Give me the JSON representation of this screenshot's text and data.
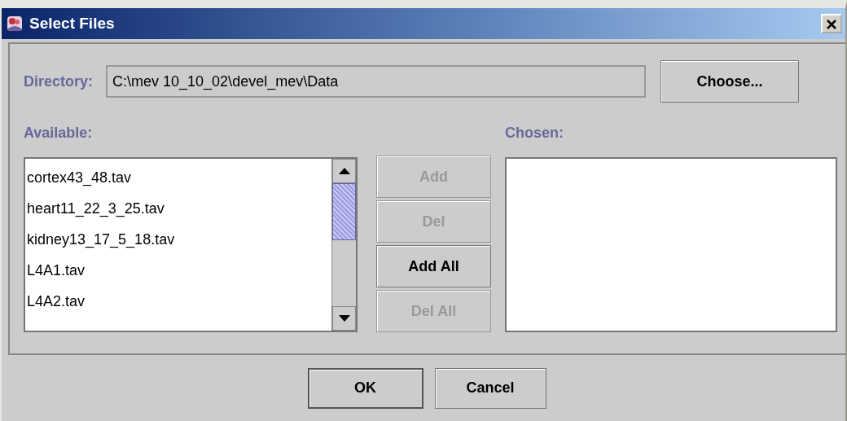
{
  "window": {
    "title": "Select Files"
  },
  "directory": {
    "label": "Directory:",
    "value": "C:\\mev 10_10_02\\devel_mev\\Data",
    "button": "Choose..."
  },
  "available": {
    "label": "Available:",
    "items": [
      "cortex43_48.tav",
      "heart11_22_3_25.tav",
      "kidney13_17_5_18.tav",
      "L4A1.tav",
      "L4A2.tav"
    ]
  },
  "transfer_buttons": [
    {
      "label": "Add",
      "disabled": true
    },
    {
      "label": "Del",
      "disabled": true
    },
    {
      "label": "Add All",
      "disabled": false
    },
    {
      "label": "Del All",
      "disabled": true
    }
  ],
  "chosen": {
    "label": "Chosen:"
  },
  "buttons": [
    {
      "label": "OK",
      "default": true
    },
    {
      "label": "Cancel",
      "default": false
    }
  ]
}
